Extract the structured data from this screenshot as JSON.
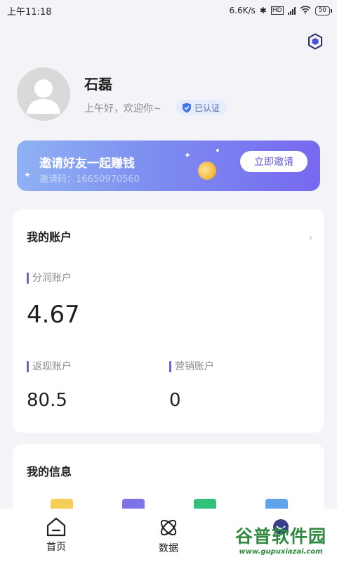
{
  "status_bar": {
    "time": "上午11:18",
    "net_speed": "6.6K/s",
    "battery": "50"
  },
  "profile": {
    "name": "石磊",
    "greeting": "上午好，欢迎你~",
    "verified_label": "已认证"
  },
  "invite": {
    "title": "邀请好友一起赚钱",
    "code": "邀请码：16650970560",
    "button": "立即邀请"
  },
  "account": {
    "title": "我的账户",
    "profit_label": "分润账户",
    "profit_value": "4.67",
    "cashback_label": "返现账户",
    "cashback_value": "80.5",
    "marketing_label": "营销账户",
    "marketing_value": "0"
  },
  "info": {
    "title": "我的信息"
  },
  "nav": {
    "home": "首页",
    "data": "数据"
  },
  "watermark": {
    "main": "谷普软件园",
    "sub": "www.gupuxiazai.com"
  },
  "colors": {
    "accent": "#6d63d9",
    "banner_start": "#8fb2f3",
    "banner_end": "#7769f0",
    "watermark": "#2d8a3e"
  }
}
